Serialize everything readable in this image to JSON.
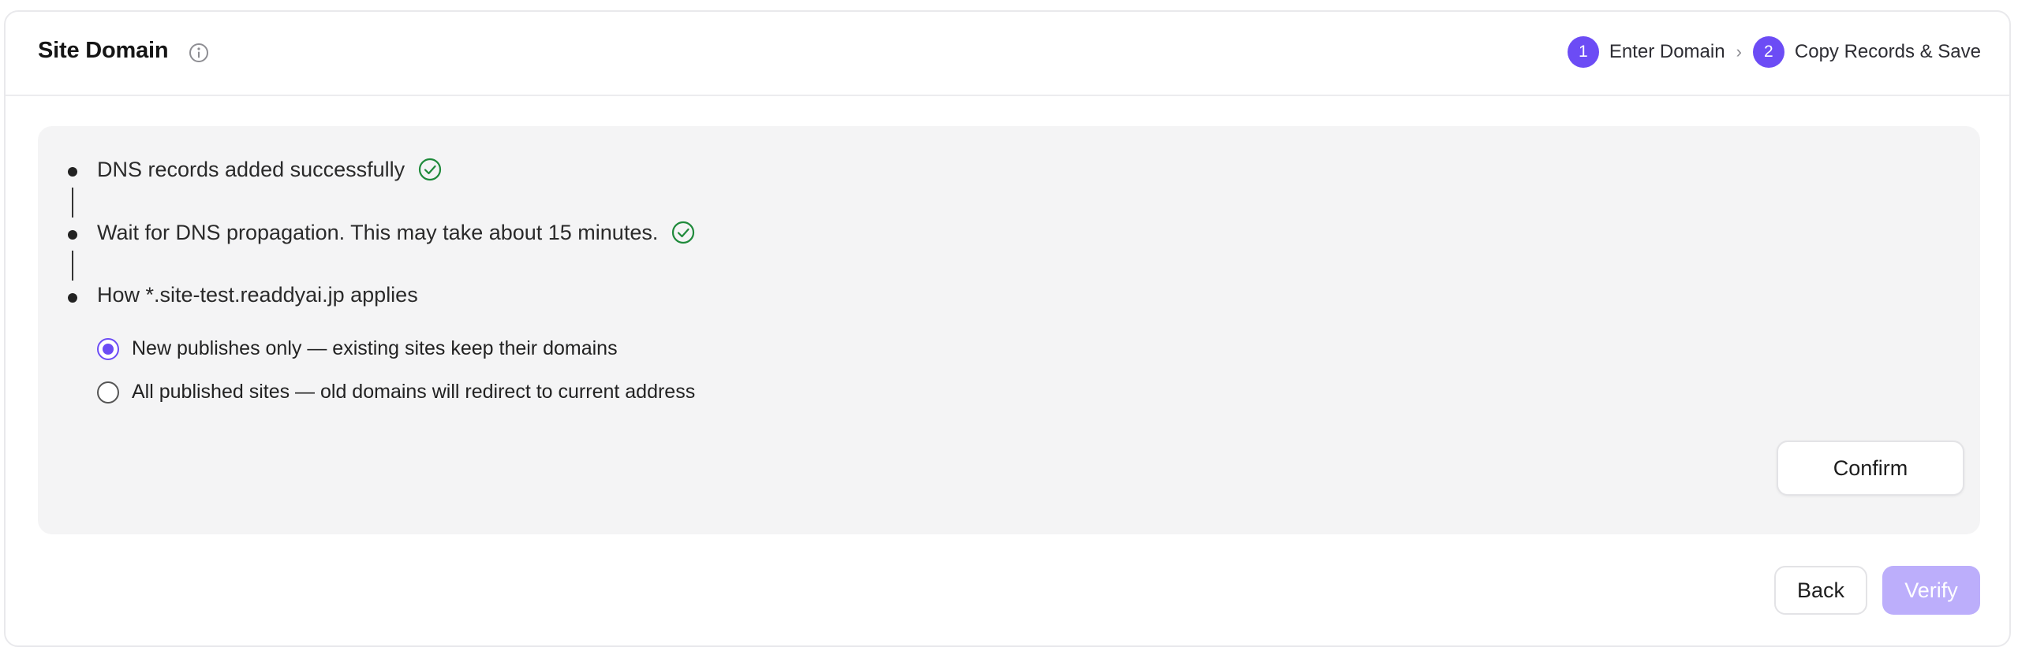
{
  "header": {
    "title": "Site Domain",
    "info_icon": "info-circle-icon",
    "steps": [
      {
        "number": "1",
        "label": "Enter Domain"
      },
      {
        "number": "2",
        "label": "Copy Records & Save"
      }
    ],
    "step_separator": "›"
  },
  "timeline": {
    "items": [
      {
        "text": "DNS records added successfully",
        "status_icon": "check-circle-icon"
      },
      {
        "text": "Wait for DNS propagation. This may take about 15 minutes.",
        "status_icon": "check-circle-icon"
      },
      {
        "text": "How *.site-test.readdyai.jp applies"
      }
    ]
  },
  "apply_options": {
    "selected": 0,
    "options": [
      {
        "label": "New publishes only — existing sites keep their domains"
      },
      {
        "label": "All published sites — old domains will redirect to current address"
      }
    ]
  },
  "buttons": {
    "confirm": "Confirm",
    "back": "Back",
    "verify": "Verify"
  },
  "colors": {
    "accent": "#6c4cf5",
    "success": "#1f8a3b",
    "verify_disabled": "#bcaefb",
    "panel_bg": "#f4f4f5"
  }
}
